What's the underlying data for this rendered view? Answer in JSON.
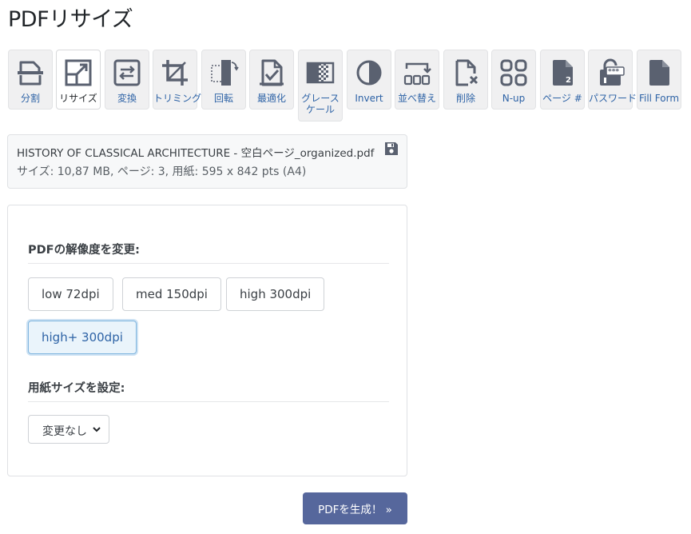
{
  "page": {
    "title": "PDFリサイズ"
  },
  "toolbar": {
    "items": [
      {
        "label": "分割",
        "icon": "split-icon"
      },
      {
        "label": "リサイズ",
        "icon": "resize-icon",
        "active": true
      },
      {
        "label": "変換",
        "icon": "convert-icon"
      },
      {
        "label": "トリミング",
        "icon": "crop-icon"
      },
      {
        "label": "回転",
        "icon": "rotate-icon"
      },
      {
        "label": "最適化",
        "icon": "optimize-icon"
      },
      {
        "label": "グレースケール",
        "icon": "grayscale-icon"
      },
      {
        "label": "Invert",
        "icon": "invert-icon"
      },
      {
        "label": "並べ替え",
        "icon": "reorder-icon"
      },
      {
        "label": "削除",
        "icon": "delete-page-icon"
      },
      {
        "label": "N-up",
        "icon": "n-up-icon"
      },
      {
        "label": "ページ #",
        "icon": "page-number-icon"
      },
      {
        "label": "パスワード",
        "icon": "password-icon"
      },
      {
        "label": "Fill Form",
        "icon": "fill-form-icon"
      }
    ]
  },
  "file": {
    "name": "HISTORY OF CLASSICAL ARCHITECTURE - 空白ページ_organized.pdf",
    "meta": "サイズ: 10,87 MB, ページ: 3, 用紙: 595 x 842 pts (A4)",
    "save_icon": "save-icon"
  },
  "resolution": {
    "label": "PDFの解像度を変更:",
    "options": [
      "low 72dpi",
      "med 150dpi",
      "high 300dpi",
      "high+ 300dpi"
    ],
    "selected": "high+ 300dpi"
  },
  "paper": {
    "label": "用紙サイズを設定:",
    "selected": "変更なし"
  },
  "generate": {
    "label": "PDFを生成！ »"
  },
  "colors": {
    "accent": "#56679c",
    "link": "#2e63a6",
    "icon": "#5a6170"
  }
}
